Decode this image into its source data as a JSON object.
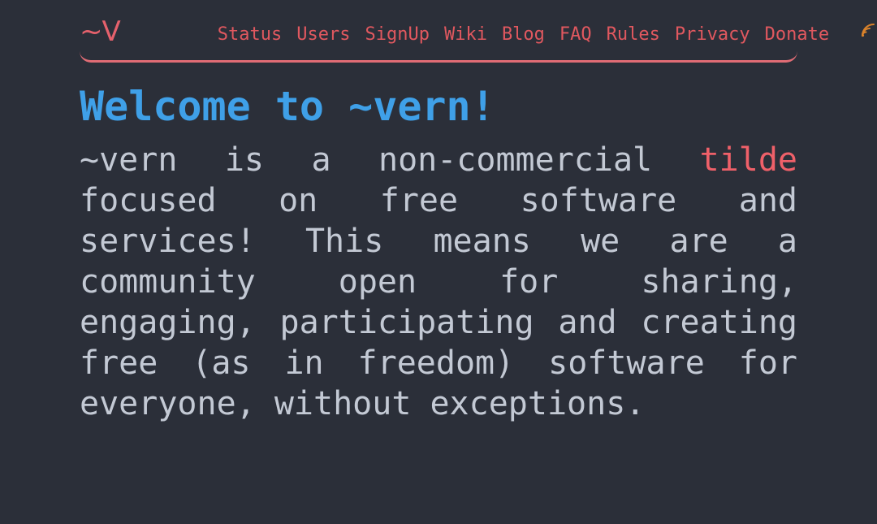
{
  "site": {
    "background_color": "#2b2f39",
    "accent_color": "#e06c75",
    "heading_color": "#3fa0e8",
    "body_text_color": "#c3c9d4",
    "rss_color": "#d9822b"
  },
  "header": {
    "brand_label": "~V",
    "nav": [
      {
        "label": "Status"
      },
      {
        "label": "Users"
      },
      {
        "label": "SignUp"
      },
      {
        "label": "Wiki"
      },
      {
        "label": "Blog"
      },
      {
        "label": "FAQ"
      },
      {
        "label": "Rules"
      },
      {
        "label": "Privacy"
      },
      {
        "label": "Donate"
      }
    ],
    "rss_icon_name": "rss-feed-icon"
  },
  "main": {
    "title": "Welcome to ~vern!",
    "intro": {
      "before_link": "~vern is a non-commercial ",
      "link_label": "tilde",
      "after_link": " focused on free software and services! This means we are a community open for sharing, engaging, participating and creating free (as in freedom) software for everyone, without exceptions."
    }
  }
}
